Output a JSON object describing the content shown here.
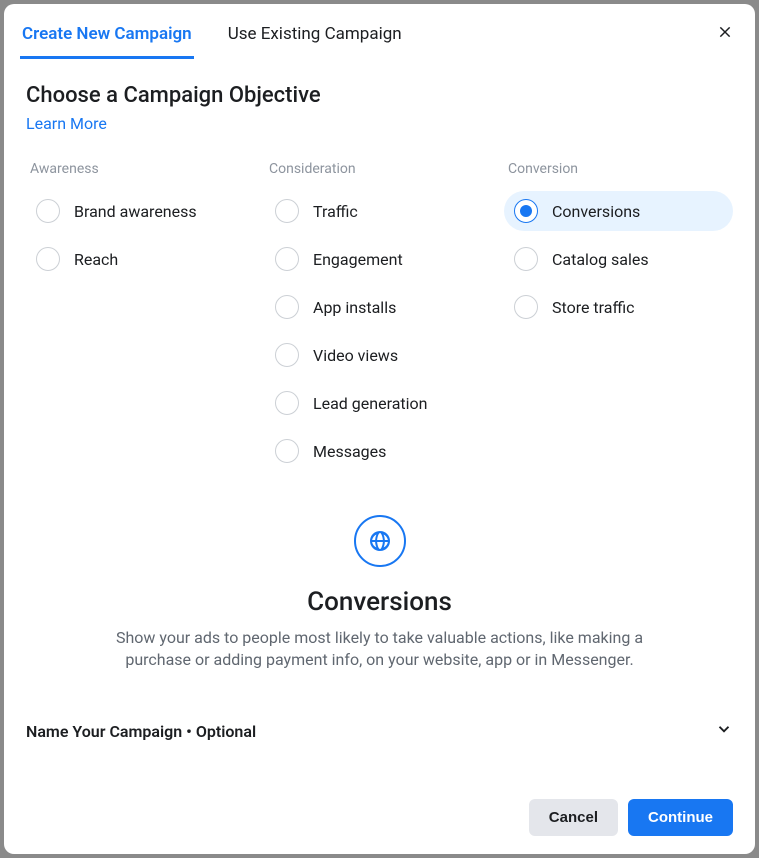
{
  "tabs": {
    "create": "Create New Campaign",
    "existing": "Use Existing Campaign"
  },
  "heading": "Choose a Campaign Objective",
  "learn_more": "Learn More",
  "columns": {
    "awareness": {
      "title": "Awareness",
      "options": [
        "Brand awareness",
        "Reach"
      ]
    },
    "consideration": {
      "title": "Consideration",
      "options": [
        "Traffic",
        "Engagement",
        "App installs",
        "Video views",
        "Lead generation",
        "Messages"
      ]
    },
    "conversion": {
      "title": "Conversion",
      "options": [
        "Conversions",
        "Catalog sales",
        "Store traffic"
      ]
    }
  },
  "selected_option": "Conversions",
  "detail": {
    "title": "Conversions",
    "description": "Show your ads to people most likely to take valuable actions, like making a purchase or adding payment info, on your website, app or in Messenger."
  },
  "collapsible": {
    "label": "Name Your Campaign • Optional"
  },
  "footer": {
    "cancel": "Cancel",
    "continue": "Continue"
  }
}
